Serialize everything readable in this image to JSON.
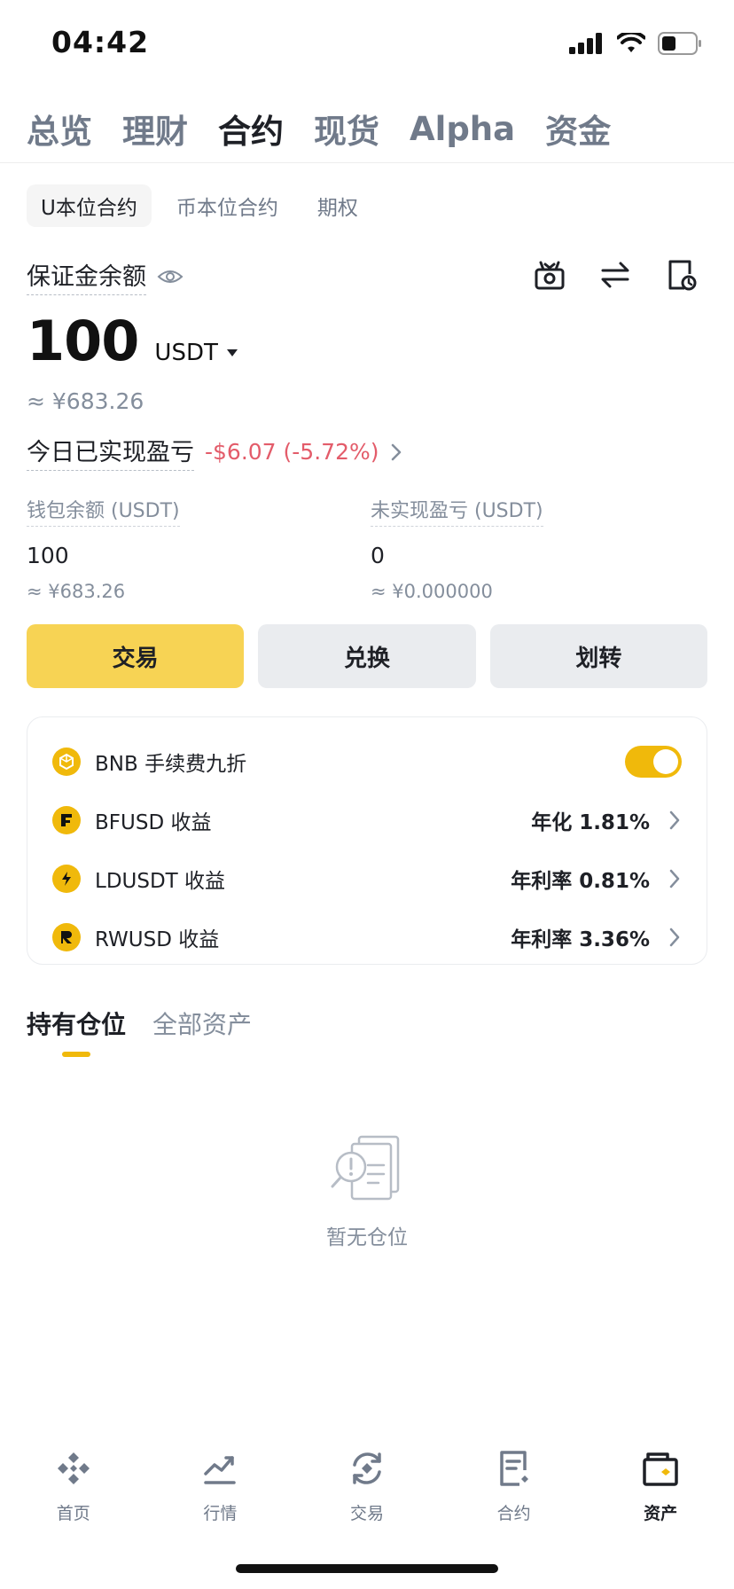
{
  "status_bar": {
    "time": "04:42"
  },
  "top_nav": {
    "items": [
      "总览",
      "理财",
      "合约",
      "现货",
      "Alpha",
      "资金"
    ],
    "active_index": 2
  },
  "sub_tabs": {
    "items": [
      "U本位合约",
      "币本位合约",
      "期权"
    ],
    "active_index": 0
  },
  "balance": {
    "label": "保证金余额",
    "value": "100",
    "unit": "USDT",
    "approx_cny": "≈ ¥683.26"
  },
  "pnl": {
    "label": "今日已实现盈亏",
    "value": "-$6.07 (-5.72%)"
  },
  "stats": {
    "wallet": {
      "label": "钱包余额 (USDT)",
      "value": "100",
      "cny": "≈ ¥683.26"
    },
    "unrealized": {
      "label": "未实现盈亏 (USDT)",
      "value": "0",
      "cny": "≈ ¥0.000000"
    }
  },
  "buttons": {
    "trade": "交易",
    "convert": "兑换",
    "transfer": "划转"
  },
  "card": {
    "bnb": {
      "name": "BNB 手续费九折",
      "toggle_on": true
    },
    "rows": [
      {
        "name": "BFUSD 收益",
        "rate": "年化 1.81%",
        "icon": "bfusd-coin-icon"
      },
      {
        "name": "LDUSDT 收益",
        "rate": "年利率 0.81%",
        "icon": "ldusdt-coin-icon"
      },
      {
        "name": "RWUSD 收益",
        "rate": "年利率 3.36%",
        "icon": "rwusd-coin-icon"
      }
    ]
  },
  "positions": {
    "tabs": [
      "持有仓位",
      "全部资产"
    ],
    "active_index": 0,
    "empty_text": "暂无仓位"
  },
  "bottom_nav": {
    "items": [
      "首页",
      "行情",
      "交易",
      "合约",
      "资产"
    ],
    "active_index": 4
  },
  "colors": {
    "brand_yellow": "#f0b90b",
    "button_yellow": "#f7d354",
    "loss_red": "#e35c6a",
    "muted": "#848e9c"
  }
}
